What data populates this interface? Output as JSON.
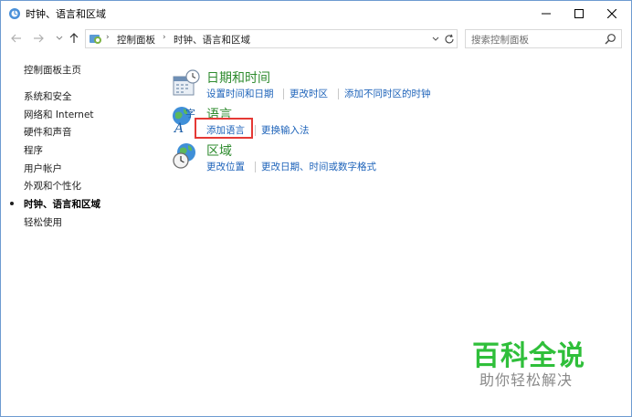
{
  "window": {
    "title": "时钟、语言和区域"
  },
  "nav": {
    "back_icon": "arrow-left-icon",
    "forward_icon": "arrow-right-icon",
    "recent_icon": "chevron-down-icon",
    "up_icon": "arrow-up-icon"
  },
  "address": {
    "segments": [
      "控制面板",
      "时钟、语言和区域"
    ]
  },
  "search": {
    "placeholder": "搜索控制面板"
  },
  "sidebar": {
    "items": [
      {
        "label": "控制面板主页",
        "active": false
      },
      {
        "label": "系统和安全",
        "active": false
      },
      {
        "label": "网络和 Internet",
        "active": false
      },
      {
        "label": "硬件和声音",
        "active": false
      },
      {
        "label": "程序",
        "active": false
      },
      {
        "label": "用户帐户",
        "active": false
      },
      {
        "label": "外观和个性化",
        "active": false
      },
      {
        "label": "时钟、语言和区域",
        "active": true
      },
      {
        "label": "轻松使用",
        "active": false
      }
    ]
  },
  "categories": [
    {
      "title": "日期和时间",
      "icon": "calendar-clock-icon",
      "links": [
        "设置时间和日期",
        "更改时区",
        "添加不同时区的时钟"
      ]
    },
    {
      "title": "语言",
      "icon": "language-icon",
      "links": [
        "添加语言",
        "更换输入法"
      ]
    },
    {
      "title": "区域",
      "icon": "globe-clock-icon",
      "links": [
        "更改位置",
        "更改日期、时间或数字格式"
      ]
    }
  ],
  "watermark": {
    "main": "百科全说",
    "sub": "助你轻松解决"
  },
  "colors": {
    "category_title": "#2e8b2e",
    "link": "#1c62b9",
    "highlight": "#e53935",
    "watermark": "#2fbf3a"
  }
}
